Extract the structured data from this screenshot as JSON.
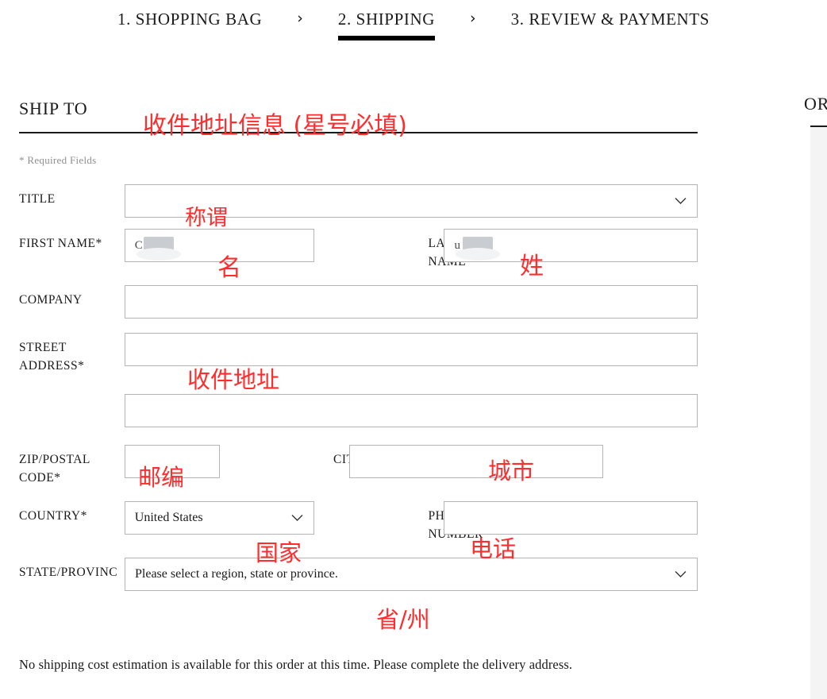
{
  "progress": {
    "steps": [
      {
        "label": "1. SHOPPING BAG",
        "active": false
      },
      {
        "label": "2. SHIPPING",
        "active": true
      },
      {
        "label": "3. REVIEW & PAYMENTS",
        "active": false
      }
    ],
    "separator": "›"
  },
  "ship_to": {
    "title": "SHIP TO",
    "required_note": "* Required Fields"
  },
  "fields": {
    "title": {
      "label": "TITLE",
      "value": ""
    },
    "first_name": {
      "label": "FIRST NAME*",
      "value": "C",
      "redacted": true
    },
    "last_name": {
      "label": "LAST NAME*",
      "value": "u",
      "redacted": true
    },
    "company": {
      "label": "COMPANY",
      "value": ""
    },
    "street_address": {
      "label": "STREET ADDRESS*",
      "value": ""
    },
    "street_address_2": {
      "label": "",
      "value": ""
    },
    "zip": {
      "label": "ZIP/POSTAL CODE*",
      "value": ""
    },
    "city": {
      "label": "CITY*",
      "value": ""
    },
    "country": {
      "label": "COUNTRY*",
      "value": "United States"
    },
    "phone": {
      "label": "PHONE NUMBER*",
      "value": ""
    },
    "state": {
      "label": "STATE/PROVINC",
      "value": "Please select a region, state or province."
    }
  },
  "order_summary": {
    "title": "OR"
  },
  "footer": {
    "estimate_note": "No shipping cost estimation is available for this order at this time. Please complete the delivery address."
  },
  "annotations": {
    "ship_to": "收件地址信息 (星号必填)",
    "title": "称谓",
    "first_name": "名",
    "last_name": "姓",
    "street_address": "收件地址",
    "zip": "邮编",
    "city": "城市",
    "country": "国家",
    "phone": "电话",
    "state": "省/州"
  },
  "colors": {
    "annotation_red": "#ff2d2d",
    "border_gray": "#b4b4b4",
    "panel_gray": "#f4f4f4",
    "active_underline": "#000000"
  }
}
